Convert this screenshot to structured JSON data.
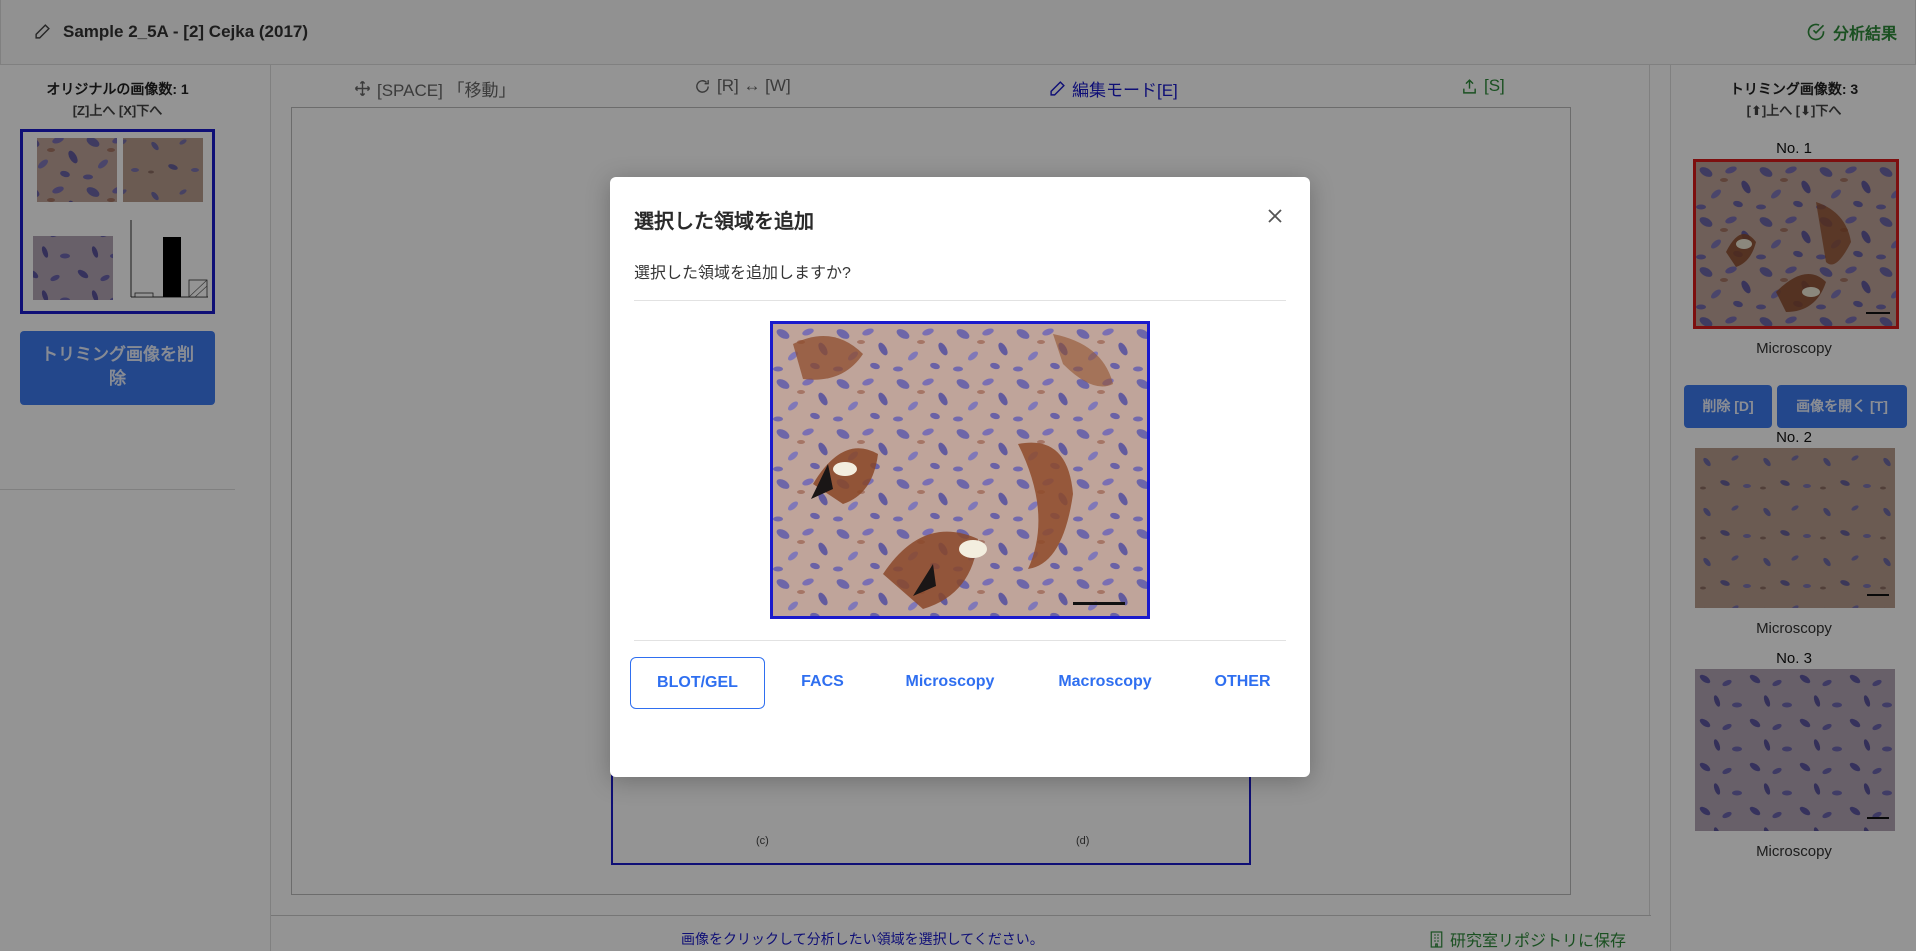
{
  "header": {
    "title": "Sample 2_5A - [2] Cejka (2017)",
    "result_label": "分析結果"
  },
  "left_panel": {
    "original_count": "オリジナルの画像数: 1",
    "nav_hint": "[Z]上へ [X]下へ",
    "delete_crop_button": "トリミング画像を削除"
  },
  "toolbar": {
    "move": "[SPACE] 「移動」",
    "rotate": "[R] ↔ [W]",
    "edit_mode": "編集モード[E]",
    "upload": "[S]"
  },
  "canvas": {
    "label_c": "(c)",
    "label_d": "(d)"
  },
  "footer": {
    "hint": "画像をクリックして分析したい領域を選択してください。",
    "save": "研究室リポジトリに保存"
  },
  "right_panel": {
    "trim_count": "トリミング画像数: 3",
    "nav_hint": "[⬆]上へ [⬇]下へ",
    "items": [
      {
        "no": "No. 1",
        "category": "Microscopy"
      },
      {
        "no": "No. 2",
        "category": "Microscopy"
      },
      {
        "no": "No. 3",
        "category": "Microscopy"
      }
    ],
    "delete_button": "削除 [D]",
    "open_button": "画像を開く [T]"
  },
  "modal": {
    "title": "選択した領域を追加",
    "question": "選択した領域を追加しますか?",
    "categories": [
      "BLOT/GEL",
      "FACS",
      "Microscopy",
      "Macroscopy",
      "OTHER"
    ],
    "selected_category": "BLOT/GEL"
  },
  "colors": {
    "accent_blue": "#2f6ff0",
    "selection_blue": "#1a1acc",
    "success_green": "#2e8b3a",
    "active_red": "#d81a1a"
  }
}
